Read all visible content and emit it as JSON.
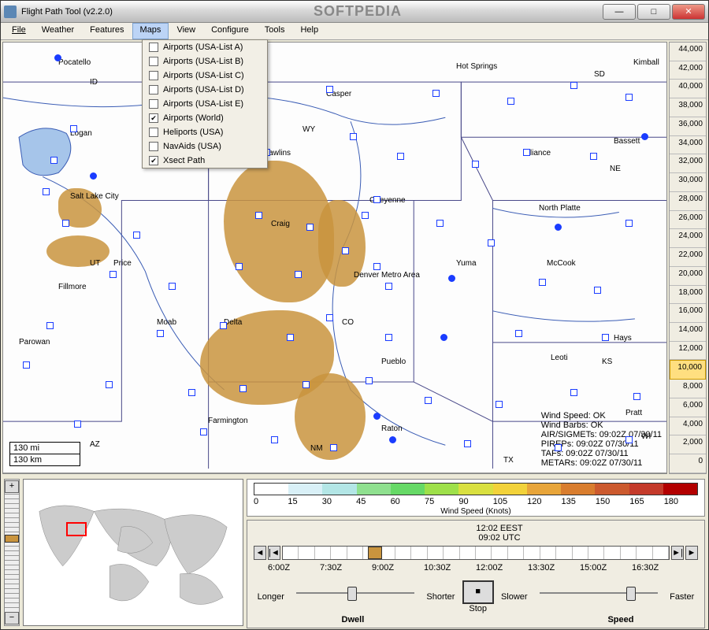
{
  "window": {
    "title": "Flight Path Tool (v2.2.0)",
    "watermark": "SOFTPEDIA"
  },
  "menu": {
    "items": [
      "File",
      "Weather",
      "Features",
      "Maps",
      "View",
      "Configure",
      "Tools",
      "Help"
    ],
    "active": "Maps"
  },
  "dropdown": [
    {
      "label": "Airports (USA-List A)",
      "checked": false
    },
    {
      "label": "Airports (USA-List B)",
      "checked": false
    },
    {
      "label": "Airports (USA-List C)",
      "checked": false
    },
    {
      "label": "Airports (USA-List D)",
      "checked": false
    },
    {
      "label": "Airports (USA-List E)",
      "checked": false
    },
    {
      "label": "Airports (World)",
      "checked": true
    },
    {
      "label": "Heliports (USA)",
      "checked": false
    },
    {
      "label": "NavAids (USA)",
      "checked": false
    },
    {
      "label": "Xsect Path",
      "checked": true
    }
  ],
  "cities": [
    "Pocatello",
    "ID",
    "Logan",
    "Salt Lake City",
    "UT",
    "Price",
    "Fillmore",
    "Parowan",
    "Moab",
    "AZ",
    "Farmington",
    "Delta",
    "Craig",
    "WY",
    "Casper",
    "Rawlins",
    "Cheyenne",
    "Denver Metro Area",
    "CO",
    "Pueblo",
    "Raton",
    "NM",
    "Hot Springs",
    "SD",
    "Alliance",
    "North Platte",
    "NE",
    "Yuma",
    "McCook",
    "Leoti",
    "KS",
    "Hays",
    "Pratt",
    "WI",
    "TX",
    "Kimball",
    "Bassett"
  ],
  "scale": {
    "mi": "130 mi",
    "km": "130 km"
  },
  "status": [
    "Wind Speed: OK",
    "Wind Barbs: OK",
    "AIR/SIGMETs: 09:02Z 07/30/11",
    "PIREPs: 09:02Z 07/30/11",
    "TAFs: 09:02Z 07/30/11",
    "METARs: 09:02Z 07/30/11"
  ],
  "altitude": {
    "values": [
      "44,000",
      "42,000",
      "40,000",
      "38,000",
      "36,000",
      "34,000",
      "32,000",
      "30,000",
      "28,000",
      "26,000",
      "24,000",
      "22,000",
      "20,000",
      "18,000",
      "16,000",
      "14,000",
      "12,000",
      "10,000",
      "8,000",
      "6,000",
      "4,000",
      "2,000",
      "0"
    ],
    "selected": "10,000"
  },
  "colorbar": {
    "title": "Wind Speed (Knots)",
    "values": [
      "0",
      "15",
      "30",
      "45",
      "60",
      "75",
      "90",
      "105",
      "120",
      "135",
      "150",
      "165",
      "180"
    ],
    "colors": [
      "#ffffff",
      "#d9f0f7",
      "#b3e6e6",
      "#8fe08f",
      "#66d966",
      "#9ee04a",
      "#d9e040",
      "#f2d23a",
      "#e8a53a",
      "#d97d2e",
      "#cc5a2e",
      "#c43a2a",
      "#b30000"
    ]
  },
  "time": {
    "local": "12:02 EEST",
    "utc": "09:02 UTC",
    "ticks": [
      "6:00Z",
      "7:30Z",
      "9:00Z",
      "10:30Z",
      "12:00Z",
      "13:30Z",
      "15:00Z",
      "16:30Z"
    ]
  },
  "playback": {
    "dwell": {
      "left": "Longer",
      "label": "Dwell",
      "right": "Shorter"
    },
    "stop": "Stop",
    "speed": {
      "left": "Slower",
      "label": "Speed",
      "right": "Faster"
    }
  },
  "zoom": {
    "plus": "+",
    "minus": "−"
  }
}
